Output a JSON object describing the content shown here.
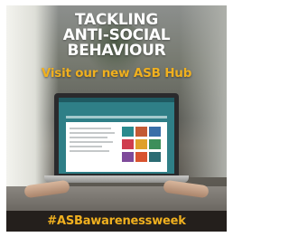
{
  "poster": {
    "headline_lines": [
      "TACKLING",
      "ANTI-SOCIAL",
      "BEHAVIOUR"
    ],
    "subheading": "Visit our new ASB Hub",
    "hashtag": "#ASBawarenessweek"
  },
  "colors": {
    "accent_gold": "#f0b01f",
    "headline_white": "#ffffff",
    "screen_teal": "#2f7f87",
    "hashtag_bar": "#241f1c"
  }
}
